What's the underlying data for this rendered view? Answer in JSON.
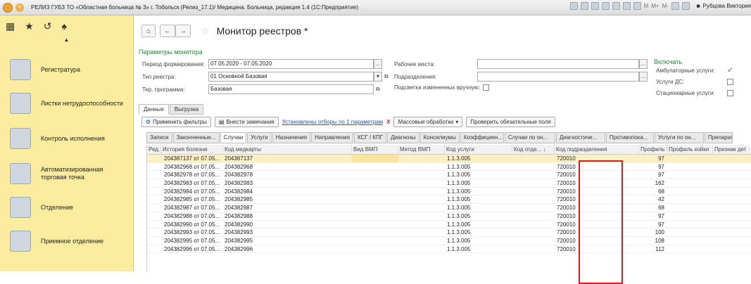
{
  "titlebar": {
    "title": "РЕЛИЗ ГУБЗ ТО «Областная больница № 3» г. Тобольск (Релиз_17.1)/ Медицина. Больница, редакция 1.4 (1С:Предприятие)",
    "btn_m": "M",
    "btn_mplus": "M+",
    "btn_mminus": "M-",
    "user": "Рубцова Виктория"
  },
  "sidebar": {
    "items": [
      {
        "label": "Регистратура",
        "icon": "registry-icon"
      },
      {
        "label": "Листки нетрудоспособности",
        "icon": "sick-leave-icon"
      },
      {
        "label": "Контроль исполнения",
        "icon": "control-icon"
      },
      {
        "label": "Автоматизированная торговая точка",
        "icon": "cash-register-icon"
      },
      {
        "label": "Отделение",
        "icon": "bed-icon"
      },
      {
        "label": "Приемное отделение",
        "icon": "doctor-icon"
      }
    ]
  },
  "header": {
    "title": "Монитор реестров *"
  },
  "params": {
    "section_title": "Параметры монитора",
    "period_label": "Период формирования:",
    "period_value": "07.05.2020 - 07.05.2020",
    "type_label": "Тип реестра:",
    "type_value": "01 Основной Базовая",
    "program_label": "Тер. программа:",
    "program_value": "Базовая",
    "workplaces_label": "Рабочие места:",
    "divisions_label": "Подразделения:",
    "highlight_label": "Подсветка измененных вручную:",
    "ellipsis": "...",
    "include_title": "Включать",
    "include": [
      {
        "label": "Амбулаторные услуги:",
        "checked": true
      },
      {
        "label": "Услуги ДС:",
        "checked": false
      },
      {
        "label": "Стационарные услуги:",
        "checked": false
      }
    ]
  },
  "tabs_main": [
    "Данные",
    "Выгрузка"
  ],
  "toolbar": {
    "apply": "Применить фильтры",
    "comments": "Внести замечания",
    "filters_link": "Установлены отборы по 1 параметрам",
    "x": "X",
    "bulk": "Массовые обработки",
    "check": "Проверить обязательные поля"
  },
  "tabs_sub": [
    "Записи",
    "Законченные...",
    "Случаи",
    "Услуги",
    "Назначения",
    "Направления",
    "КСГ / КПГ",
    "Диагнозы",
    "Консилиумы",
    "Коэффициен...",
    "Случаи по он...",
    "Диагностиче...",
    "Противопока...",
    "Услуги по он...",
    "Препарат"
  ],
  "grid": {
    "columns": [
      "Ред.",
      "История болезни",
      "Код медкарты",
      "Вид ВМП",
      "Метод ВМП",
      "Код услуги",
      "Код отде...",
      "Код подразделения",
      "Профиль",
      "Профиль койки",
      "Признак дет"
    ],
    "rows": [
      {
        "hist": "204387137 от 07.05...",
        "card": "204387137",
        "code": "1.1.3.005",
        "unit": "720010",
        "profile": "97"
      },
      {
        "hist": "204382968 от 07.05...",
        "card": "204382968",
        "code": "1.1.3.005",
        "unit": "720010",
        "profile": "97"
      },
      {
        "hist": "204382978 от 07.05...",
        "card": "204382978",
        "code": "1.1.3.005",
        "unit": "720010",
        "profile": "97"
      },
      {
        "hist": "204382983 от 07.05...",
        "card": "204382983",
        "code": "1.1.3.005",
        "unit": "720010",
        "profile": "162"
      },
      {
        "hist": "204382984 от 07.05...",
        "card": "204382984",
        "code": "1.1.3.005",
        "unit": "720010",
        "profile": "68"
      },
      {
        "hist": "204382985 от 07.05...",
        "card": "204382985",
        "code": "1.1.3.005",
        "unit": "720010",
        "profile": "42"
      },
      {
        "hist": "204382987 от 07.05...",
        "card": "204382987",
        "code": "1.1.3.005",
        "unit": "720010",
        "profile": "68"
      },
      {
        "hist": "204382988 от 07.05...",
        "card": "204382988",
        "code": "1.1.3.005",
        "unit": "720010",
        "profile": "97"
      },
      {
        "hist": "204382990 от 07.05...",
        "card": "204382990",
        "code": "1.1.3.005",
        "unit": "720010",
        "profile": "97"
      },
      {
        "hist": "204382993 от 07.05...",
        "card": "204382993",
        "code": "1.1.3.005",
        "unit": "720010",
        "profile": "100"
      },
      {
        "hist": "204382995 от 07.05...",
        "card": "204382995",
        "code": "1.1.3.005",
        "unit": "720010",
        "profile": "108"
      },
      {
        "hist": "204382996 от 07.05...",
        "card": "204382996",
        "code": "1.1.3.005",
        "unit": "720010",
        "profile": "112"
      }
    ]
  },
  "colors": {
    "sidebar": "#fbec9f",
    "accent_green": "#2a8a3a",
    "highlight_box": "#e21b1b",
    "selected_row": "#fdf1c3",
    "link": "#1b55c8"
  }
}
